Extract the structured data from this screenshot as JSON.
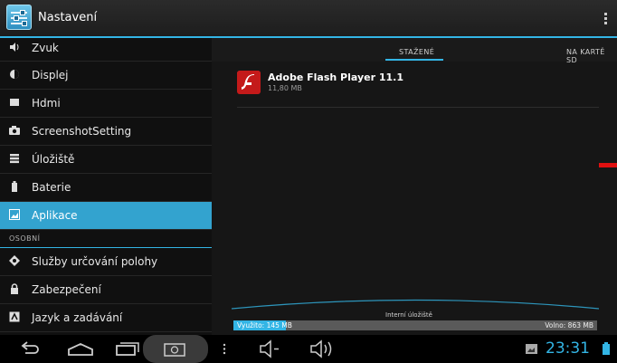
{
  "app": {
    "title": "Nastavení",
    "icon": "settings-sliders-icon"
  },
  "sidebar": {
    "items": [
      {
        "label": "Zvuk",
        "icon": "speaker-icon"
      },
      {
        "label": "Displej",
        "icon": "display-icon"
      },
      {
        "label": "Hdmi",
        "icon": "hdmi-icon"
      },
      {
        "label": "ScreenshotSetting",
        "icon": "camera-icon"
      },
      {
        "label": "Úložiště",
        "icon": "storage-icon"
      },
      {
        "label": "Baterie",
        "icon": "battery-icon"
      },
      {
        "label": "Aplikace",
        "icon": "apps-icon",
        "active": true
      }
    ],
    "section_label": "OSOBNÍ",
    "personal_items": [
      {
        "label": "Služby určování polohy",
        "icon": "location-icon"
      },
      {
        "label": "Zabezpečení",
        "icon": "lock-icon"
      },
      {
        "label": "Jazyk a zadávání",
        "icon": "keyboard-icon"
      }
    ]
  },
  "tabs": [
    {
      "label": "STAŽENÉ",
      "selected": true
    },
    {
      "label": "NA KARTĚ SD",
      "selected": false
    }
  ],
  "apps": [
    {
      "name": "Adobe Flash Player 11.1",
      "size": "11,80 MB",
      "icon": "flash-player-icon"
    }
  ],
  "storage": {
    "title": "Interní úložiště",
    "used": "Využito: 145 MB",
    "free": "Volno: 863 MB",
    "used_fraction": 0.144
  },
  "status": {
    "time": "23:31"
  },
  "navigation": [
    "back-icon",
    "home-icon",
    "recent-apps-icon",
    "screenshot-icon",
    "menu-dots-icon",
    "volume-down-icon",
    "volume-up-icon",
    "gallery-notification-icon",
    "battery-status-icon"
  ],
  "colors": {
    "accent": "#33b5e5",
    "active_item": "#33a3cf",
    "flash_red": "#e01010"
  }
}
